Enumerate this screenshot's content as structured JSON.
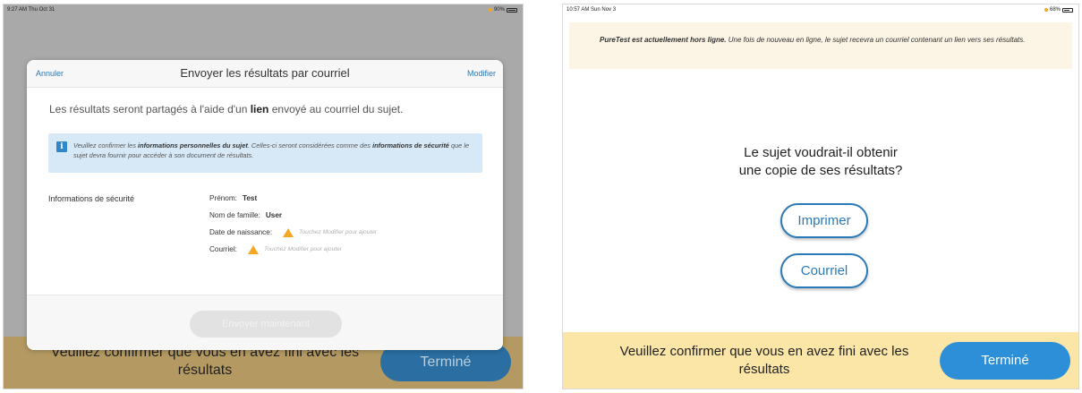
{
  "left_screen": {
    "status_bar": {
      "time": "9:27 AM  Thu Oct 31",
      "battery": "90%"
    },
    "modal": {
      "cancel_label": "Annuler",
      "title": "Envoyer les résultats par courriel",
      "edit_label": "Modifier",
      "intro_before": "Les résultats seront partagés à l'aide d'un ",
      "intro_bold": "lien",
      "intro_after": " envoyé au courriel du sujet.",
      "info_1": "Veuillez confirmer les ",
      "info_2": "informations personnelles du sujet",
      "info_3": ". Celles-ci seront considérées comme des ",
      "info_4": "informations de sécurité",
      "info_5": " que le sujet devra fournir pour accéder à son document de résultats.",
      "security_label": "Informations de sécurité",
      "fields": {
        "first_name_label": "Prénom:",
        "first_name_value": "Test",
        "last_name_label": "Nom de famille:",
        "last_name_value": "User",
        "dob_label": "Date de naissance:",
        "dob_hint": "Touchez Modifier pour ajouter",
        "email_label": "Courriel:",
        "email_hint": "Touchez Modifier pour ajouter"
      },
      "send_label": "Envoyer maintenant"
    },
    "banner": {
      "message": "Veuillez confirmer que vous en avez fini avec les résultats",
      "done_label": "Terminé"
    }
  },
  "right_screen": {
    "status_bar": {
      "time": "10:57 AM  Sun Nov 3",
      "battery": "68%"
    },
    "offline_bold": "PureTest est actuellement hors ligne.",
    "offline_rest": " Une fois de nouveau en ligne, le sujet recevra un courriel contenant un lien vers ses résultats.",
    "question_line1": "Le sujet voudrait-il obtenir",
    "question_line2": "une copie de ses résultats?",
    "print_label": "Imprimer",
    "email_label": "Courriel",
    "banner": {
      "message": "Veuillez confirmer que vous en avez fini avec les résultats",
      "done_label": "Terminé"
    }
  },
  "colors": {
    "accent_blue": "#2a7ab8",
    "warning_orange": "#f5a623",
    "banner_yellow": "#fbe6a8",
    "info_blue_bg": "#d7e9f7"
  },
  "icons": [
    "info-icon",
    "warning-icon",
    "battery-icon",
    "charging-dot-icon"
  ]
}
